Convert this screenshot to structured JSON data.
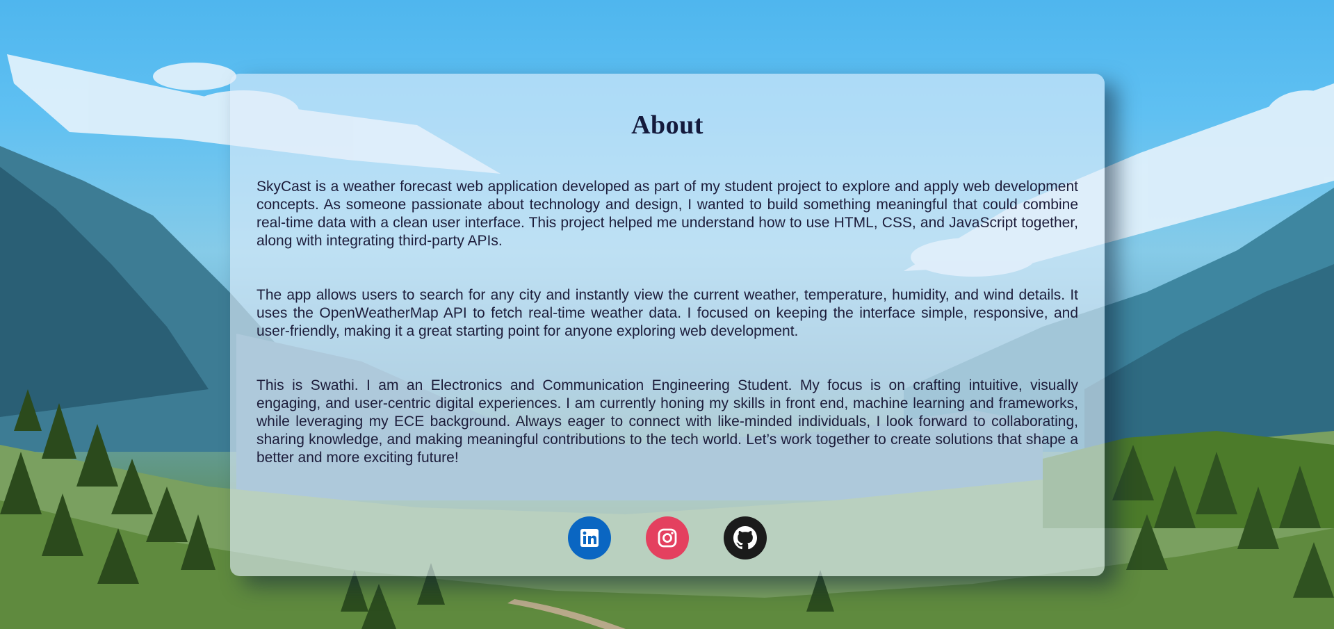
{
  "about": {
    "title": "About",
    "paragraphs": [
      "SkyCast is a weather forecast web application developed as part of my student project to explore and apply web development concepts. As someone passionate about technology and design, I wanted to build something meaningful that could combine real-time data with a clean user interface. This project helped me understand how to use HTML, CSS, and JavaScript together, along with integrating third-party APIs.",
      "The app allows users to search for any city and instantly view the current weather, temperature, humidity, and wind details. It uses the OpenWeatherMap API to fetch real-time weather data. I focused on keeping the interface simple, responsive, and user-friendly, making it a great starting point for anyone exploring web development.",
      "This is Swathi. I am an Electronics and Communication Engineering Student. My focus is on crafting intuitive, visually engaging, and user-centric digital experiences. I am currently honing my skills in front end, machine learning and frameworks, while leveraging my ECE background. Always eager to connect with like-minded individuals, I look forward to collaborating, sharing knowledge, and making meaningful contributions to the tech world. Let’s work together to create solutions that shape a better and more exciting future!"
    ]
  },
  "social": [
    {
      "icon": "linkedin-icon",
      "color": "#0a66c2"
    },
    {
      "icon": "instagram-icon",
      "color": "#e4405f"
    },
    {
      "icon": "github-icon",
      "color": "#1b1b1b"
    }
  ],
  "colors": {
    "sky": "#4fb6ee",
    "card_text": "#1c1c3a",
    "title": "#141a3c"
  }
}
